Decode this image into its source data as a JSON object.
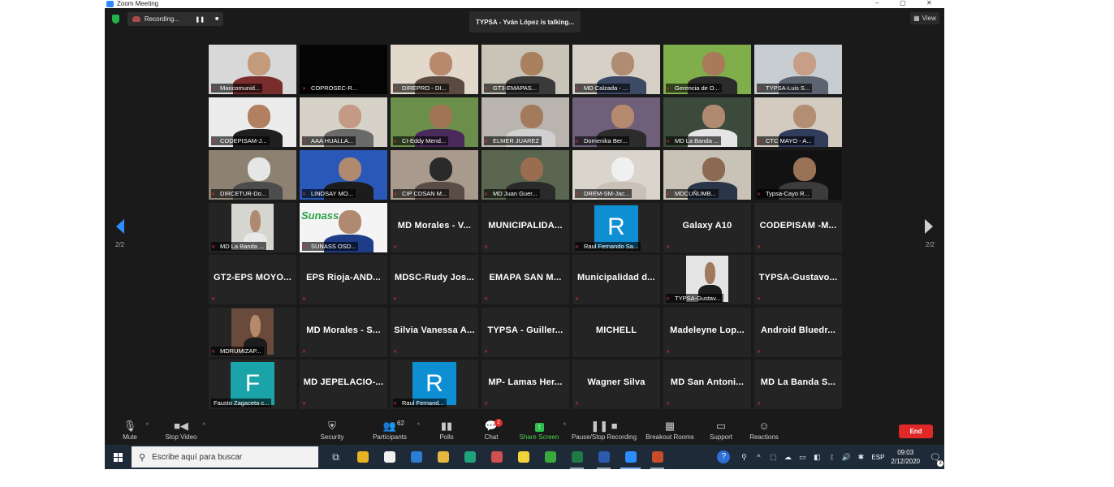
{
  "window": {
    "title": "Zoom Meeting",
    "controls": [
      "–",
      "▢",
      "✕"
    ]
  },
  "recording": {
    "label": "Recording...",
    "pause_icon": "❚❚",
    "stop_icon": "■"
  },
  "speaker_banner": "TYPSA - Yván López is talking...",
  "view_button": {
    "label": "View",
    "icon": "grid-icon"
  },
  "pagination": {
    "left": "2/2",
    "right": "2/2"
  },
  "tiles": [
    {
      "type": "video",
      "name": "Mancomunid...",
      "bg": "#d8d8d8",
      "skin": "#c39a7a",
      "shirt": "#7a2d2d"
    },
    {
      "type": "video",
      "name": "COPROSEC-R...",
      "bg": "#050505",
      "skin": "#050505",
      "shirt": "#050505"
    },
    {
      "type": "video",
      "name": "DIREPRO - DI...",
      "bg": "#e2d8cc",
      "skin": "#b8896a",
      "shirt": "#5a4a40"
    },
    {
      "type": "video",
      "name": "GT3-EMAPAS...",
      "bg": "#c9c4b8",
      "skin": "#a9805e",
      "shirt": "#3a3a3a"
    },
    {
      "type": "video",
      "name": "MD Calzada - ...",
      "bg": "#d6d0c6",
      "skin": "#b08c70",
      "shirt": "#3c4a66"
    },
    {
      "type": "video",
      "name": "Gerencia de D...",
      "bg": "#7fae4a",
      "skin": "#a97a5a",
      "shirt": "#2b2b2b"
    },
    {
      "type": "video",
      "name": "TYPSA-Luis S...",
      "bg": "#c8cdd2",
      "skin": "#c79f86",
      "shirt": "#5b6470"
    },
    {
      "type": "video",
      "name": "CODEPISAM-J...",
      "bg": "#ececec",
      "skin": "#b08060",
      "shirt": "#1f1f1f"
    },
    {
      "type": "video",
      "name": "AAA HUALLA...",
      "bg": "#d7d2c8",
      "skin": "#c49a84",
      "shirt": "#6a6a6a"
    },
    {
      "type": "video",
      "name": "CI-Eddy Mend...",
      "bg": "#6b8f4a",
      "skin": "#a07555",
      "shirt": "#4a2a5a"
    },
    {
      "type": "video",
      "name": "ELMER JUAREZ",
      "bg": "#b9b5ae",
      "skin": "#a47a5c",
      "shirt": "#d0d0d0"
    },
    {
      "type": "video",
      "name": "Domenika Ber...",
      "bg": "#6f5f7a",
      "skin": "#b58a6e",
      "shirt": "#2c2c2c"
    },
    {
      "type": "video",
      "name": "MD La Banda ...",
      "bg": "#3b4a3a",
      "skin": "#b08a70",
      "shirt": "#e5e5e5"
    },
    {
      "type": "video",
      "name": "CTC MAYO - A...",
      "bg": "#d3cbc0",
      "skin": "#b48e72",
      "shirt": "#2f3c5a"
    },
    {
      "type": "video",
      "name": "DIRCETUR-Do...",
      "bg": "#8d8272",
      "skin": "#e6e6e6",
      "shirt": "#4c4c4c"
    },
    {
      "type": "video",
      "name": "LINDSAY MO...",
      "bg": "#2a58b8",
      "skin": "#b08a6e",
      "shirt": "#1c1c1c"
    },
    {
      "type": "video",
      "name": "CIP CDSAN M...",
      "bg": "#a99a8e",
      "skin": "#2a2a2a",
      "shirt": "#5a4c46"
    },
    {
      "type": "video",
      "name": "MD Juan Guer...",
      "bg": "#5a6650",
      "skin": "#9a6d50",
      "shirt": "#2a2a2a"
    },
    {
      "type": "video",
      "name": "DREM-SM-Jac...",
      "bg": "#d9d4cc",
      "skin": "#f0f0f0",
      "shirt": "#c9c0b8"
    },
    {
      "type": "video",
      "name": "MDCUÑUMB...",
      "bg": "#c9c2b6",
      "skin": "#8c6a52",
      "shirt": "#2a3548"
    },
    {
      "type": "video",
      "name": "Typsa-Cayo R...",
      "bg": "#121212",
      "skin": "#9a7256",
      "shirt": "#3c3c3c"
    },
    {
      "type": "minivideo",
      "name": "MD La Banda ...",
      "bg": "#d6d6d0",
      "skin": "#b08a70",
      "shirt": "#e8e8e8"
    },
    {
      "type": "video",
      "name": "SUNASS OSD...",
      "bg": "#f4f4f4",
      "skin": "#b08a70",
      "shirt": "#1f3c88",
      "logo": "Sunass"
    },
    {
      "type": "text",
      "label": "MD Morales - V..."
    },
    {
      "type": "text",
      "label": "MUNICIPALIDA..."
    },
    {
      "type": "avatar",
      "letter": "R",
      "name": "Raul Fernando Sa...",
      "color": "#0e8fd4"
    },
    {
      "type": "text",
      "label": "Galaxy A10"
    },
    {
      "type": "text",
      "label": "CODEPISAM -M..."
    },
    {
      "type": "text",
      "label": "GT2-EPS MOYO..."
    },
    {
      "type": "text",
      "label": "EPS Rioja-AND..."
    },
    {
      "type": "text",
      "label": "MDSC-Rudy Jos..."
    },
    {
      "type": "text",
      "label": "EMAPA SAN M..."
    },
    {
      "type": "text",
      "label": "Municipalidad d..."
    },
    {
      "type": "minivideo",
      "name": "TYPSA-Gustav...",
      "bg": "#e4e4e4",
      "skin": "#a0785c",
      "shirt": "#1d1d1d"
    },
    {
      "type": "text",
      "label": "TYPSA-Gustavo..."
    },
    {
      "type": "minivideo",
      "name": "MDRUMIZAP...",
      "bg": "#6a4a3a",
      "skin": "#b58a6c",
      "shirt": "#1c1c1c"
    },
    {
      "type": "text",
      "label": "MD Morales - S..."
    },
    {
      "type": "text",
      "label": "Silvia Vanessa A..."
    },
    {
      "type": "text",
      "label": "TYPSA - Guiller..."
    },
    {
      "type": "text",
      "label": "MICHELL",
      "nomic": true
    },
    {
      "type": "text",
      "label": "Madeleyne Lop..."
    },
    {
      "type": "text",
      "label": "Android Bluedr..."
    },
    {
      "type": "avatar",
      "letter": "F",
      "name": "Fausto Zagaceta c...",
      "color": "#1aa3a8",
      "nomic": true
    },
    {
      "type": "text",
      "label": "MD JEPELACIO-..."
    },
    {
      "type": "avatar",
      "letter": "R",
      "name": "Raul Fernand...",
      "color": "#0e8fd4"
    },
    {
      "type": "text",
      "label": "MP- Lamas Her..."
    },
    {
      "type": "text",
      "label": "Wagner Silva"
    },
    {
      "type": "text",
      "label": "MD San Antoni..."
    },
    {
      "type": "text",
      "label": "MD La Banda S..."
    }
  ],
  "toolbar": {
    "mute": {
      "label": "Mute",
      "icon": "microphone-icon"
    },
    "video": {
      "label": "Stop Video",
      "icon": "video-camera-icon"
    },
    "security": {
      "label": "Security",
      "icon": "shield-icon"
    },
    "participants": {
      "label": "Participants",
      "count": "62",
      "icon": "people-icon"
    },
    "polls": {
      "label": "Polls",
      "icon": "bar-chart-icon"
    },
    "chat": {
      "label": "Chat",
      "badge": "2",
      "icon": "chat-bubble-icon"
    },
    "share": {
      "label": "Share Screen",
      "icon": "share-arrow-icon"
    },
    "record": {
      "label": "Pause/Stop Recording",
      "icon": "pause-stop-icon"
    },
    "breakout": {
      "label": "Breakout Rooms",
      "icon": "rooms-grid-icon"
    },
    "support": {
      "label": "Support",
      "icon": "support-screen-icon"
    },
    "reactions": {
      "label": "Reactions",
      "icon": "smiley-plus-icon"
    },
    "end": {
      "label": "End"
    }
  },
  "taskbar": {
    "search_placeholder": "Escribe aquí para buscar",
    "apps": [
      {
        "name": "task-view-icon",
        "color": "#1e2a38",
        "glyph": "⧉",
        "state": ""
      },
      {
        "name": "chrome-icon",
        "color": "#e8b322",
        "state": ""
      },
      {
        "name": "store-icon",
        "color": "#f0f0f0",
        "state": ""
      },
      {
        "name": "vscode-icon",
        "color": "#2a7fd4",
        "state": ""
      },
      {
        "name": "file-explorer-icon",
        "color": "#e6b840",
        "state": ""
      },
      {
        "name": "edge-icon",
        "color": "#1fa37a",
        "state": ""
      },
      {
        "name": "snipping-tool-icon",
        "color": "#d05050",
        "state": ""
      },
      {
        "name": "sticky-notes-icon",
        "color": "#f2d43a",
        "state": ""
      },
      {
        "name": "camtasia-icon",
        "color": "#3aa83a",
        "state": ""
      },
      {
        "name": "excel-icon",
        "color": "#1f7a45",
        "state": "open"
      },
      {
        "name": "word-icon",
        "color": "#2b5aaf",
        "state": "open"
      },
      {
        "name": "zoom-icon",
        "color": "#2d8cff",
        "state": "active"
      },
      {
        "name": "powerpoint-icon",
        "color": "#c84b2c",
        "state": "open"
      }
    ],
    "tray_icons": [
      "^",
      "⬚",
      "☁",
      "▭",
      "◧",
      "ﾐ",
      "🔊",
      "✱"
    ],
    "language": "ESP",
    "time": "09:03",
    "date": "2/12/2020",
    "notification_count": "3"
  }
}
